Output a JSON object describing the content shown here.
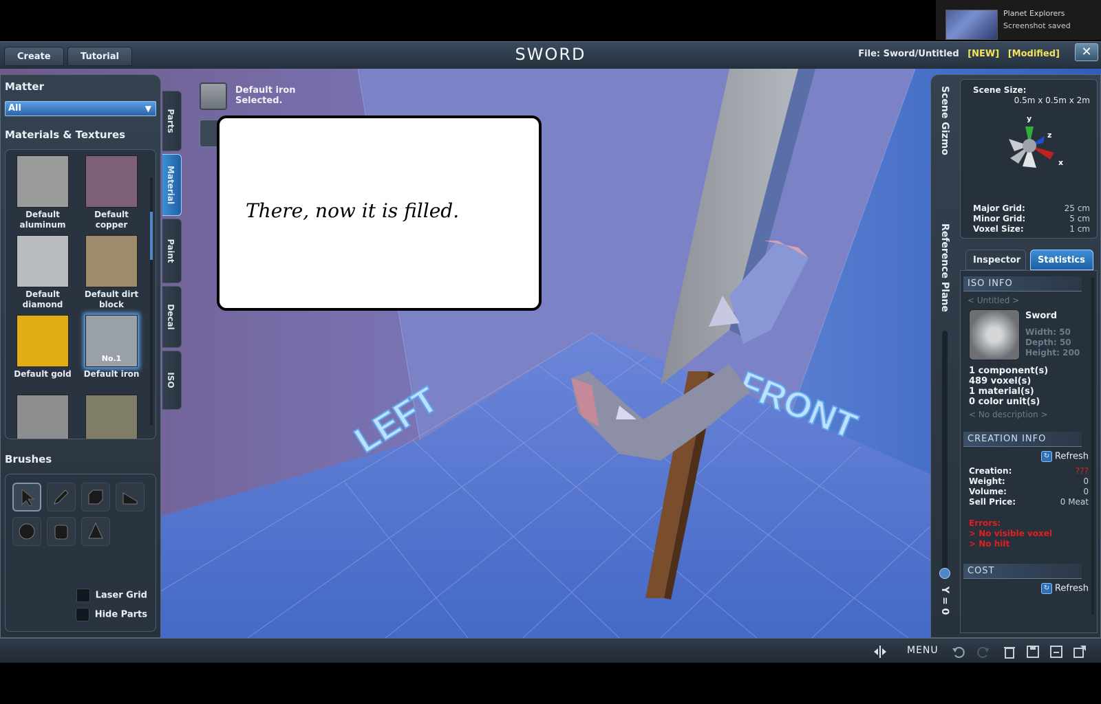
{
  "notification": {
    "app": "Planet Explorers",
    "message": "Screenshot saved"
  },
  "topbar": {
    "tabs": [
      "Create",
      "Tutorial"
    ],
    "title": "SWORD",
    "file_label": "File:",
    "file_name": "Sword/Untitled",
    "flag_new": "[NEW]",
    "flag_modified": "[Modified]",
    "close": "✕"
  },
  "left_panel": {
    "matter_title": "Matter",
    "matter_selected": "All",
    "materials_title": "Materials & Textures",
    "materials": [
      {
        "name": "Default aluminum",
        "color": "#9a9c9c"
      },
      {
        "name": "Default copper",
        "color": "#7d6078"
      },
      {
        "name": "Default diamond",
        "color": "#b8bcbe"
      },
      {
        "name": "Default dirt block",
        "color": "#a08a6e"
      },
      {
        "name": "Default gold",
        "color": "#e0ad12"
      },
      {
        "name": "Default iron",
        "color": "#9aa0a8",
        "badge": "No.1",
        "selected": true
      },
      {
        "name": "",
        "color": "#8c8e8f"
      },
      {
        "name": "",
        "color": "#7f7c68"
      }
    ],
    "brushes_title": "Brushes",
    "brushes": [
      "select-arrow",
      "pencil",
      "box",
      "slope",
      "sphere",
      "cylinder",
      "cone"
    ],
    "laser_grid": "Laser Grid",
    "hide_parts": "Hide Parts"
  },
  "side_tabs": [
    "Parts",
    "Material",
    "Paint",
    "Decal",
    "ISO"
  ],
  "active_side_tab": "Material",
  "selection": {
    "line1": "Default iron",
    "line2": "Selected."
  },
  "bubble": {
    "text": "There, now it is filled."
  },
  "viewport": {
    "label_left": "LEFT",
    "label_front": "FRONT"
  },
  "right_panel": {
    "scene_gizmo": "Scene Gizmo",
    "reference_plane": "Reference Plane",
    "y_value": "Y = 0",
    "scene_size_label": "Scene Size:",
    "scene_size": "0.5m x 0.5m x 2m",
    "axes": {
      "y": "y",
      "z": "z",
      "x": "x"
    },
    "major_grid_label": "Major Grid:",
    "major_grid": "25 cm",
    "minor_grid_label": "Minor Grid:",
    "minor_grid": "5 cm",
    "voxel_size_label": "Voxel Size:",
    "voxel_size": "1 cm",
    "tabs": [
      "Inspector",
      "Statistics"
    ],
    "iso_info": "ISO INFO",
    "untitled": "< Untitled >",
    "item_name": "Sword",
    "width": "Width: 50",
    "depth": "Depth: 50",
    "height": "Height: 200",
    "components": "1 component(s)",
    "voxels": "489 voxel(s)",
    "materials": "1 material(s)",
    "color_units": "0 color unit(s)",
    "no_description": "< No description >",
    "creation_info": "CREATION INFO",
    "refresh": "Refresh",
    "creation_label": "Creation:",
    "creation": "???",
    "weight_label": "Weight:",
    "weight": "0",
    "volume_label": "Volume:",
    "volume": "0",
    "sell_label": "Sell Price:",
    "sell": "0 Meat",
    "errors_label": "Errors:",
    "error1": "> No visible voxel",
    "error2": "> No hilt",
    "cost": "COST"
  },
  "bottombar": {
    "menu": "MENU"
  }
}
